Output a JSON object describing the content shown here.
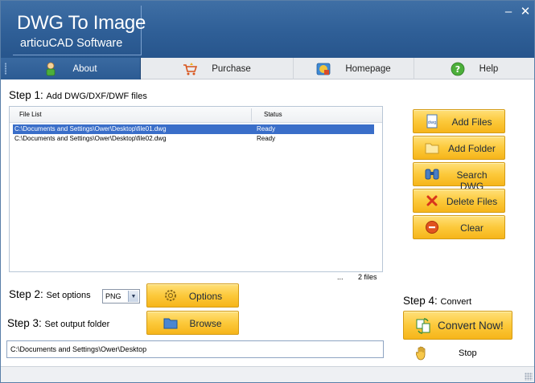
{
  "window": {
    "title": "DWG To Image",
    "subtitle": "articuCAD Software",
    "minimize_glyph": "–",
    "close_glyph": "✕"
  },
  "tabs": [
    {
      "label": "About",
      "icon": "person-icon",
      "active": true
    },
    {
      "label": "Purchase",
      "icon": "shopping-cart-icon",
      "active": false
    },
    {
      "label": "Homepage",
      "icon": "globe-icon",
      "active": false
    },
    {
      "label": "Help",
      "icon": "help-icon",
      "active": false
    }
  ],
  "step1": {
    "num": "Step 1:",
    "text": "Add DWG/DXF/DWF files"
  },
  "file_list": {
    "columns": [
      "File List",
      "Status"
    ],
    "rows": [
      {
        "path": "C:\\Documents and Settings\\Ower\\Desktop\\file01.dwg",
        "status": "Ready",
        "selected": true
      },
      {
        "path": "C:\\Documents and Settings\\Ower\\Desktop\\file02.dwg",
        "status": "Ready",
        "selected": false
      }
    ],
    "ellipsis": "...",
    "count": "2 files"
  },
  "side_buttons": [
    {
      "label": "Add Files",
      "icon": "dwg-file-icon"
    },
    {
      "label": "Add Folder",
      "icon": "folder-icon"
    },
    {
      "label": "Search DWG",
      "icon": "binoculars-icon"
    },
    {
      "label": "Delete Files",
      "icon": "delete-x-icon"
    },
    {
      "label": "Clear",
      "icon": "clear-minus-icon"
    }
  ],
  "step2": {
    "num": "Step 2:",
    "text": "Set options",
    "format": "PNG",
    "options_label": "Options"
  },
  "step3": {
    "num": "Step 3:",
    "text": "Set output folder",
    "browse_label": "Browse",
    "output_path": "C:\\Documents and Settings\\Ower\\Desktop"
  },
  "step4": {
    "num": "Step 4:",
    "text": "Convert",
    "convert_label": "Convert Now!",
    "stop_label": "Stop"
  },
  "colors": {
    "title_bar": "#2f5f97",
    "button_gold": "#fcc93b",
    "selection": "#3a6ec9"
  }
}
